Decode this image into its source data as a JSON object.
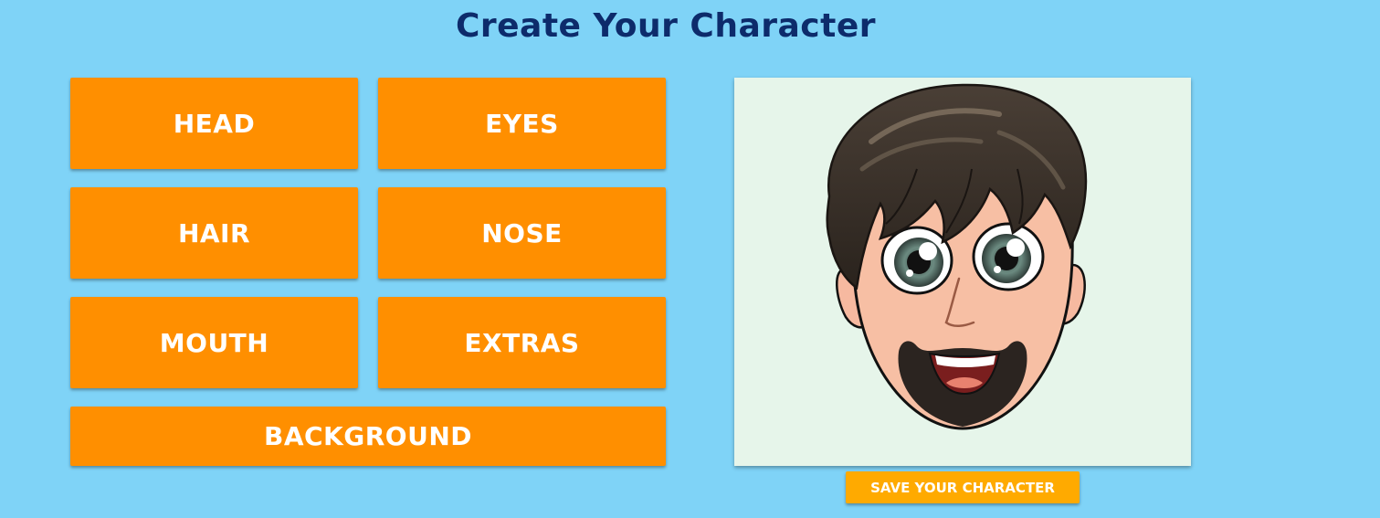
{
  "page": {
    "title": "Create Your Character"
  },
  "categories": {
    "head": "HEAD",
    "eyes": "EYES",
    "hair": "HAIR",
    "nose": "NOSE",
    "mouth": "MOUTH",
    "extras": "EXTRAS",
    "background": "BACKGROUND"
  },
  "actions": {
    "save_label": "SAVE YOUR CHARACTER"
  },
  "colors": {
    "page_background": "#7fd3f7",
    "title": "#0d2b6b",
    "category_button": "#ff8f00",
    "save_button": "#ffaa00",
    "preview_background": "#e6f5ea"
  }
}
